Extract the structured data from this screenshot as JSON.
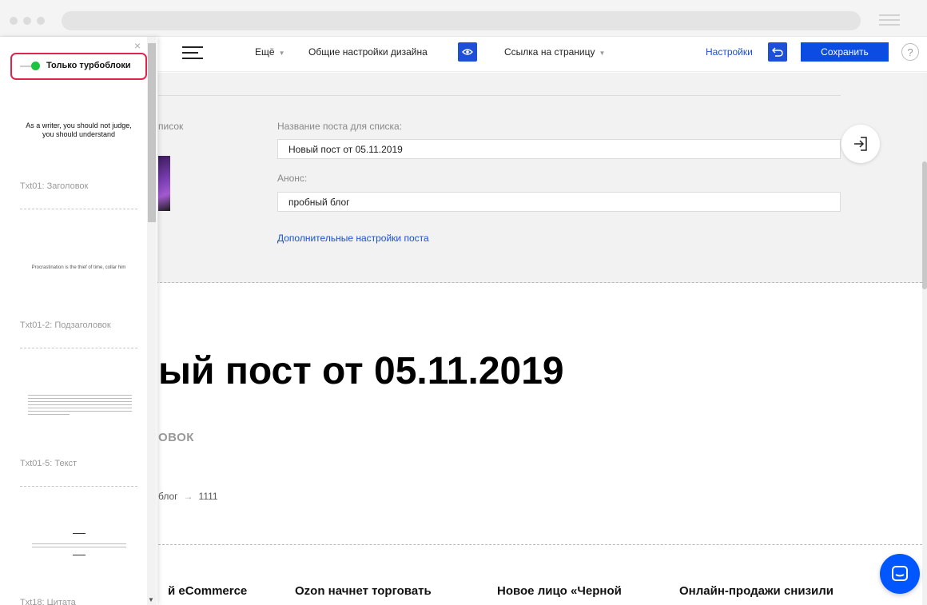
{
  "toolbar": {
    "more_label": "Ещё",
    "design_settings_label": "Общие настройки дизайна",
    "page_link_label": "Ссылка на страницу",
    "settings_label": "Настройки",
    "save_label": "Сохранить",
    "help_label": "?"
  },
  "settings": {
    "list_label_partial": "писок",
    "title_field_label": "Название поста для списка:",
    "title_field_value": "Новый пост от 05.11.2019",
    "announce_label": "Анонс:",
    "announce_value": "пробный блог",
    "more_link": "Дополнительные настройки поста"
  },
  "content": {
    "post_title_visible": "ый пост от 05.11.2019",
    "subtitle_visible": "ОВОК",
    "breadcrumb": [
      "блог",
      "1111"
    ],
    "news": [
      "й eCommerce",
      "Ozon начнет торговать",
      "Новое лицо «Черной",
      "Онлайн-продажи снизили"
    ]
  },
  "panel": {
    "toggle_label": "Только турбоблоки",
    "templates": [
      {
        "preview_text": "As a writer, you should not judge, you should understand",
        "name": "Txt01: Заголовок"
      },
      {
        "preview_text": "Procrastination is the thief of time, collar him",
        "name": "Txt01-2: Подзаголовок"
      },
      {
        "preview_text": "",
        "name": "Txt01-5: Текст"
      },
      {
        "preview_text": "",
        "name": "Txt18: Цитата"
      }
    ]
  },
  "colors": {
    "accent_blue": "#0b4de2",
    "toggle_green": "#1bc440",
    "highlight_red": "#e0234e",
    "chat_blue": "#0057ff"
  }
}
